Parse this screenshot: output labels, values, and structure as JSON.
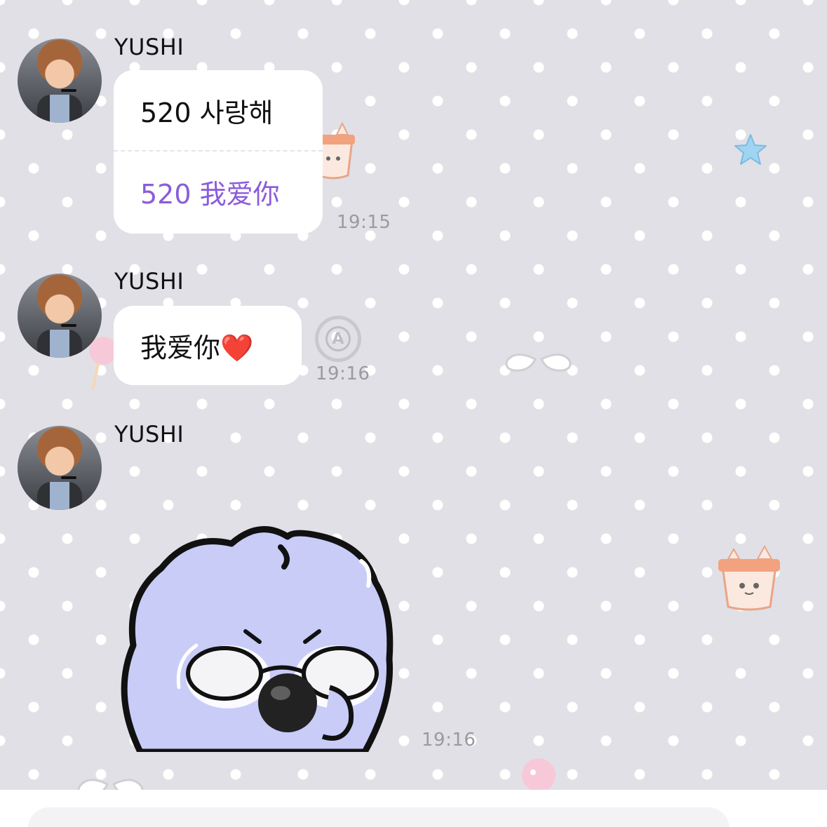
{
  "messages": [
    {
      "sender": "YUSHI",
      "original": "520 사랑해",
      "translated": "520 我爱你",
      "time": "19:15"
    },
    {
      "sender": "YUSHI",
      "text": "我爱你❤️",
      "time": "19:16",
      "action_icon": "translate-icon"
    },
    {
      "sender": "YUSHI",
      "content": "sticker",
      "time": "19:16"
    }
  ],
  "colors": {
    "background": "#e1e0e6",
    "translated_text": "#8a5cdb",
    "timestamp": "#9a9a9f"
  }
}
